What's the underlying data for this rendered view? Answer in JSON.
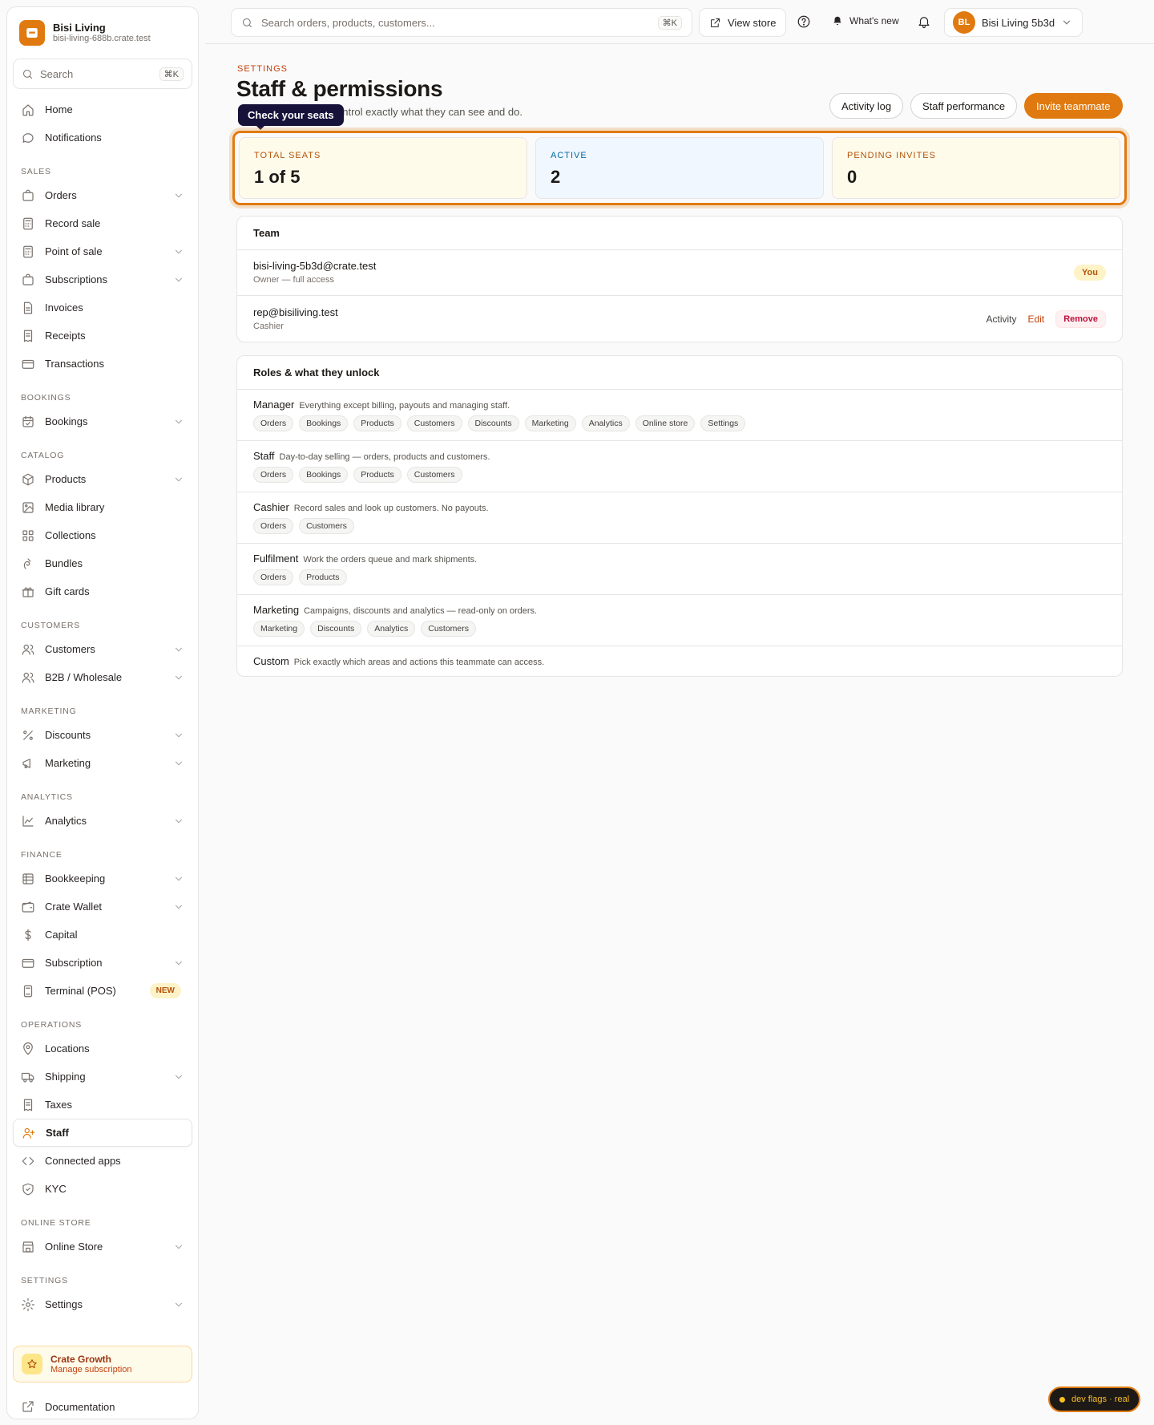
{
  "brand": {
    "name": "Bisi Living",
    "url": "bisi-living-688b.crate.test"
  },
  "sidebar": {
    "search_placeholder": "Search",
    "search_shortcut": "⌘K",
    "items": [
      {
        "label": "Home",
        "icon": "home-icon"
      },
      {
        "label": "Notifications",
        "icon": "chat-bubble-icon"
      }
    ],
    "sections": [
      {
        "title": "SALES",
        "items": [
          {
            "label": "Orders",
            "icon": "bag-icon",
            "chevron": true
          },
          {
            "label": "Record sale",
            "icon": "calculator-icon"
          },
          {
            "label": "Point of sale",
            "icon": "calculator-icon",
            "chevron": true
          },
          {
            "label": "Subscriptions",
            "icon": "bag-icon",
            "chevron": true
          },
          {
            "label": "Invoices",
            "icon": "document-icon"
          },
          {
            "label": "Receipts",
            "icon": "receipt-icon"
          },
          {
            "label": "Transactions",
            "icon": "credit-card-icon"
          }
        ]
      },
      {
        "title": "BOOKINGS",
        "items": [
          {
            "label": "Bookings",
            "icon": "calendar-icon",
            "chevron": true
          }
        ]
      },
      {
        "title": "CATALOG",
        "items": [
          {
            "label": "Products",
            "icon": "cube-icon",
            "chevron": true
          },
          {
            "label": "Media library",
            "icon": "image-icon"
          },
          {
            "label": "Collections",
            "icon": "grid-icon"
          },
          {
            "label": "Bundles",
            "icon": "bundle-icon"
          },
          {
            "label": "Gift cards",
            "icon": "gift-icon"
          }
        ]
      },
      {
        "title": "CUSTOMERS",
        "items": [
          {
            "label": "Customers",
            "icon": "users-icon",
            "chevron": true
          },
          {
            "label": "B2B / Wholesale",
            "icon": "users-icon",
            "chevron": true
          }
        ]
      },
      {
        "title": "MARKETING",
        "items": [
          {
            "label": "Discounts",
            "icon": "discount-icon",
            "chevron": true
          },
          {
            "label": "Marketing",
            "icon": "megaphone-icon",
            "chevron": true
          }
        ]
      },
      {
        "title": "ANALYTICS",
        "items": [
          {
            "label": "Analytics",
            "icon": "chart-line-icon",
            "chevron": true
          }
        ]
      },
      {
        "title": "FINANCE",
        "items": [
          {
            "label": "Bookkeeping",
            "icon": "ledger-icon",
            "chevron": true
          },
          {
            "label": "Crate Wallet",
            "icon": "wallet-icon",
            "chevron": true
          },
          {
            "label": "Capital",
            "icon": "dollar-icon"
          },
          {
            "label": "Subscription",
            "icon": "credit-card-icon",
            "chevron": true
          },
          {
            "label": "Terminal (POS)",
            "icon": "terminal-icon",
            "badge": "NEW"
          }
        ]
      },
      {
        "title": "OPERATIONS",
        "items": [
          {
            "label": "Locations",
            "icon": "pin-icon"
          },
          {
            "label": "Shipping",
            "icon": "truck-icon",
            "chevron": true
          },
          {
            "label": "Taxes",
            "icon": "receipt-icon"
          },
          {
            "label": "Staff",
            "icon": "user-plus-icon",
            "active": true
          },
          {
            "label": "Connected apps",
            "icon": "code-icon"
          },
          {
            "label": "KYC",
            "icon": "shield-icon"
          }
        ]
      },
      {
        "title": "ONLINE STORE",
        "items": [
          {
            "label": "Online Store",
            "icon": "store-icon",
            "chevron": true
          }
        ]
      },
      {
        "title": "SETTINGS",
        "items": [
          {
            "label": "Settings",
            "icon": "gear-icon",
            "chevron": true
          }
        ]
      }
    ],
    "growth": {
      "title": "Crate Growth",
      "subtitle": "Manage subscription"
    },
    "docs_label": "Documentation"
  },
  "topbar": {
    "search_placeholder": "Search orders, products, customers...",
    "search_shortcut": "⌘K",
    "view_store": "View store",
    "whats_new": "What's new",
    "account_initials": "BL",
    "account_name": "Bisi Living 5b3d"
  },
  "page": {
    "eyebrow": "SETTINGS",
    "title": "Staff & permissions",
    "subtitle_visible": "ontrol exactly what they can see and do.",
    "tooltip": "Check your seats",
    "actions": {
      "activity_log": "Activity log",
      "staff_performance": "Staff performance",
      "invite": "Invite teammate"
    }
  },
  "stats": [
    {
      "label": "TOTAL SEATS",
      "value": "1 of 5",
      "color": "#b45309",
      "bg": "#fffbeb"
    },
    {
      "label": "ACTIVE",
      "value": "2",
      "color": "#0369a1",
      "bg": "#f0f7ff"
    },
    {
      "label": "PENDING INVITES",
      "value": "0",
      "color": "#b45309",
      "bg": "#fffbeb"
    }
  ],
  "team": {
    "title": "Team",
    "members": [
      {
        "email": "bisi-living-5b3d@crate.test",
        "role": "Owner — full access",
        "tag": "You"
      },
      {
        "email": "rep@bisiliving.test",
        "role": "Cashier",
        "actions": [
          "Activity",
          "Edit",
          "Remove"
        ]
      }
    ]
  },
  "roles": {
    "title": "Roles & what they unlock",
    "items": [
      {
        "name": "Manager",
        "desc": "Everything except billing, payouts and managing staff.",
        "chips": [
          "Orders",
          "Bookings",
          "Products",
          "Customers",
          "Discounts",
          "Marketing",
          "Analytics",
          "Online store",
          "Settings"
        ]
      },
      {
        "name": "Staff",
        "desc": "Day-to-day selling — orders, products and customers.",
        "chips": [
          "Orders",
          "Bookings",
          "Products",
          "Customers"
        ]
      },
      {
        "name": "Cashier",
        "desc": "Record sales and look up customers. No payouts.",
        "chips": [
          "Orders",
          "Customers"
        ]
      },
      {
        "name": "Fulfilment",
        "desc": "Work the orders queue and mark shipments.",
        "chips": [
          "Orders",
          "Products"
        ]
      },
      {
        "name": "Marketing",
        "desc": "Campaigns, discounts and analytics — read-only on orders.",
        "chips": [
          "Marketing",
          "Discounts",
          "Analytics",
          "Customers"
        ]
      },
      {
        "name": "Custom",
        "desc": "Pick exactly which areas and actions this teammate can access.",
        "chips": []
      }
    ]
  },
  "dev_flags": "dev flags · real",
  "colors": {
    "accent": "#e07a10",
    "danger": "#be123c"
  }
}
